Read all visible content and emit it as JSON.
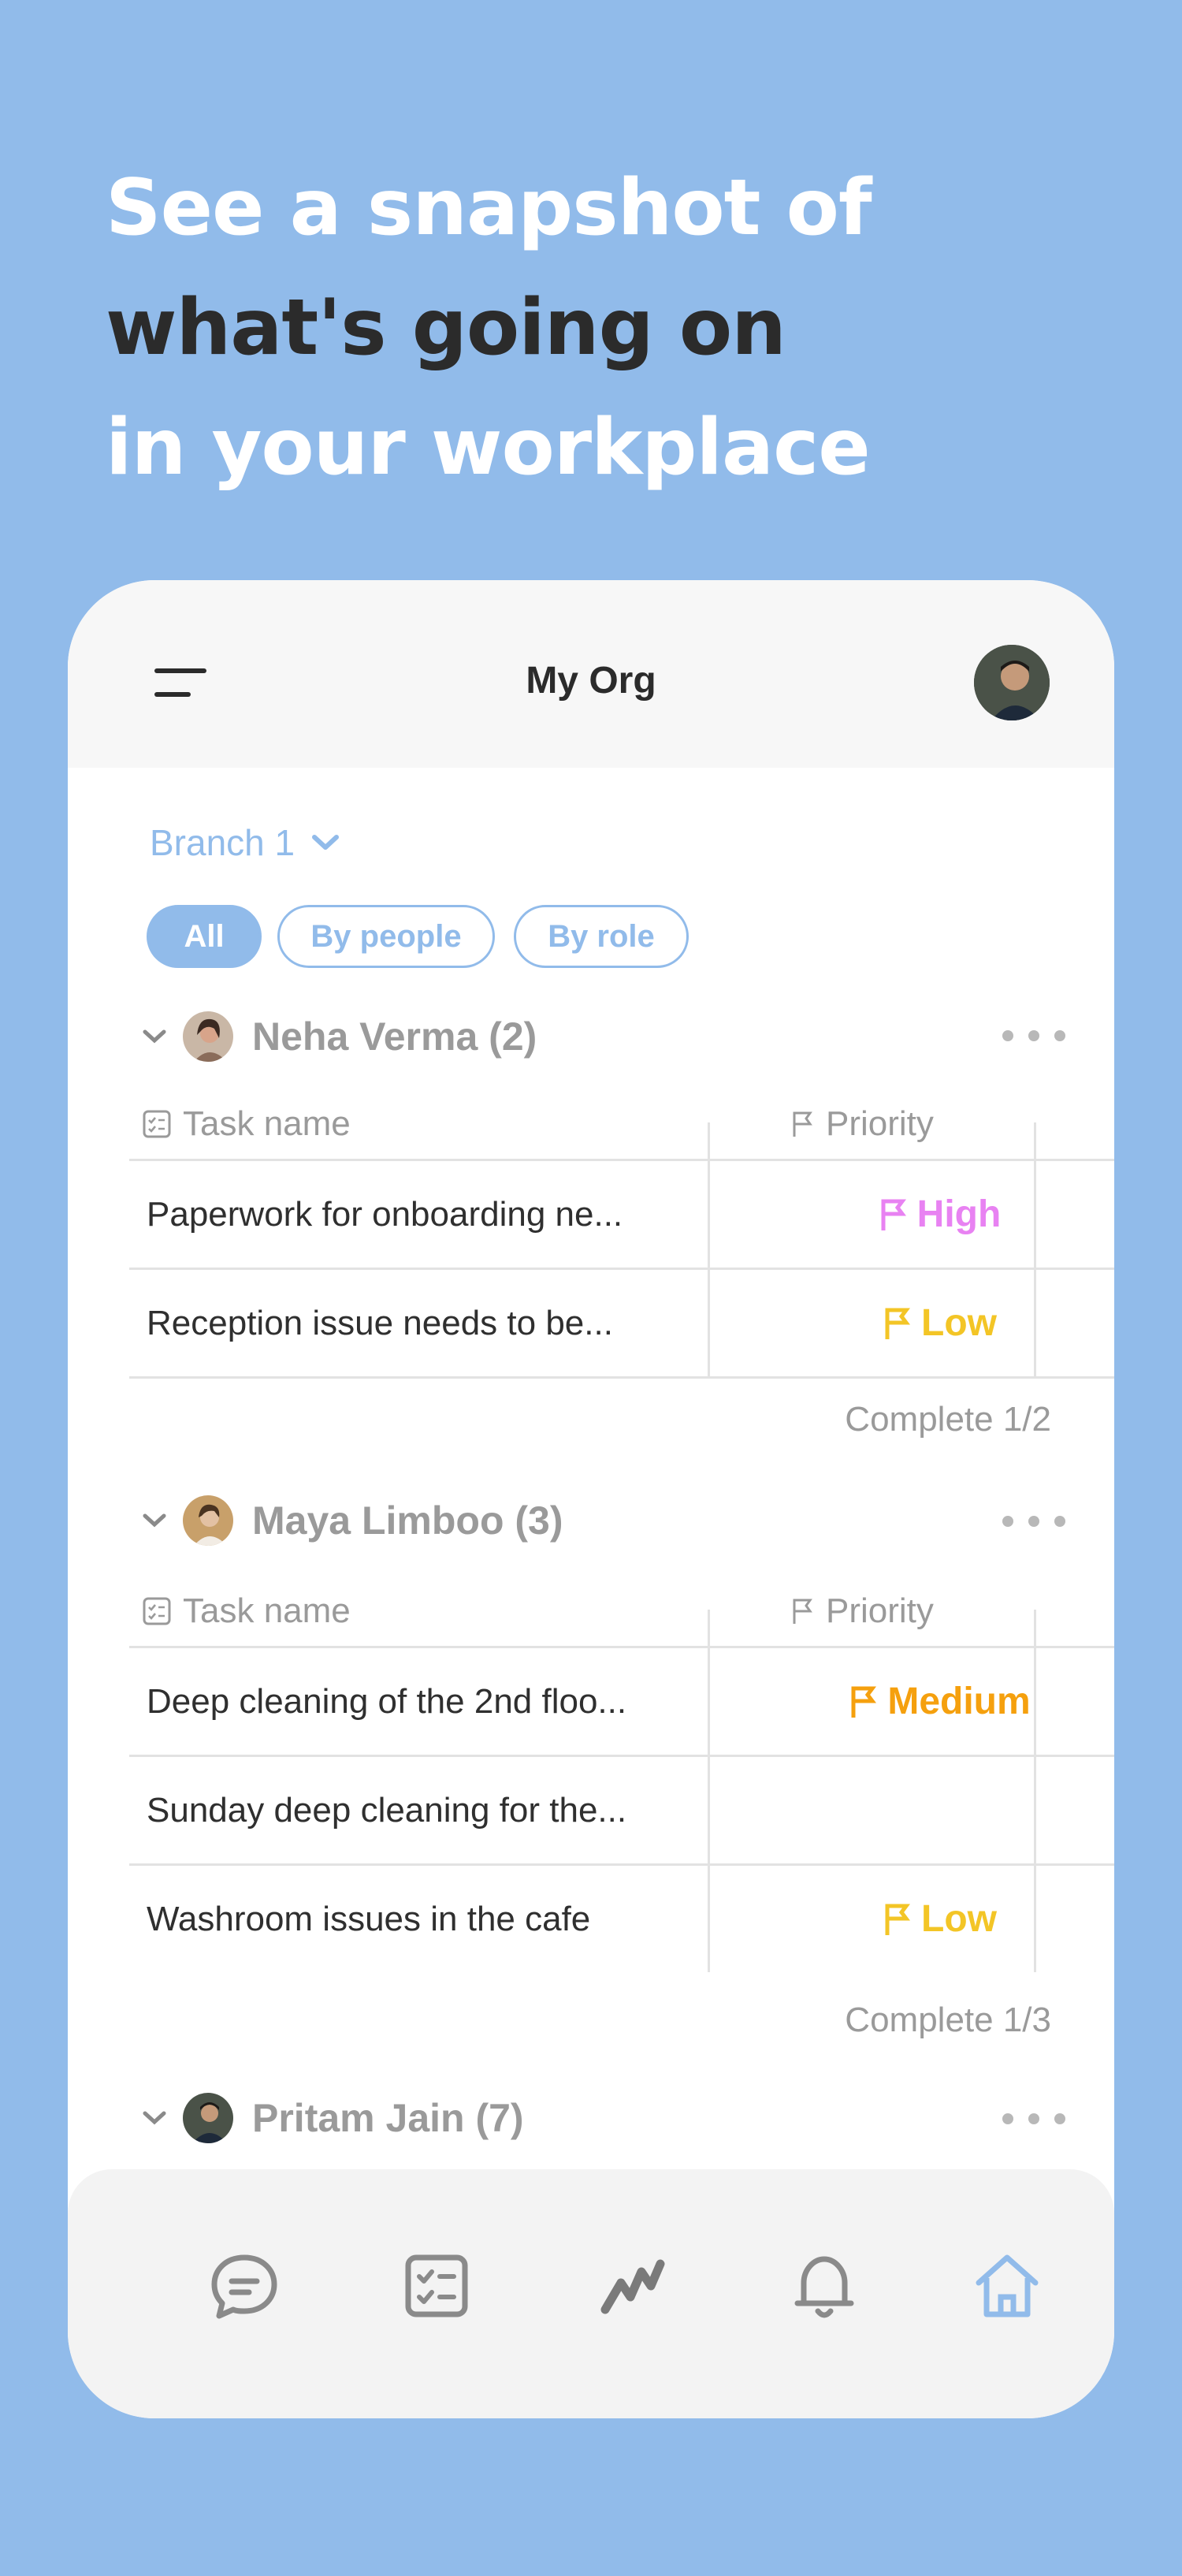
{
  "headline": {
    "line1": "See a snapshot of",
    "line2": "what's going on",
    "line3": "in your workplace"
  },
  "app": {
    "title": "My Org",
    "branch": "Branch 1",
    "filters": [
      "All",
      "By people",
      "By role"
    ]
  },
  "table_headers": {
    "task_name": "Task name",
    "priority": "Priority",
    "person_partial": "P"
  },
  "groups": [
    {
      "name": "Neha Verma (2)",
      "tasks": [
        {
          "name": "Paperwork for onboarding ne...",
          "priority": "High"
        },
        {
          "name": "Reception issue needs to be...",
          "priority": "Low"
        }
      ],
      "complete": "Complete 1/2"
    },
    {
      "name": "Maya Limboo (3)",
      "tasks": [
        {
          "name": "Deep cleaning of the 2nd floo...",
          "priority": "Medium"
        },
        {
          "name": "Sunday deep cleaning for the...",
          "priority": ""
        },
        {
          "name": "Washroom issues in the cafe",
          "priority": "Low"
        }
      ],
      "complete": "Complete 1/3"
    },
    {
      "name": "Pritam Jain (7)"
    }
  ],
  "priority_colors": {
    "High": "#e882f2",
    "Low": "#f3c526",
    "Medium": "#f5a00e"
  },
  "colors": {
    "background": "#91bbea",
    "accent": "#91bbea",
    "text_dark": "#2b2b2b",
    "muted": "#9a9a9a"
  },
  "nav": [
    {
      "icon": "chat-icon",
      "active": false
    },
    {
      "icon": "tasks-checklist-icon",
      "active": false
    },
    {
      "icon": "activity-icon",
      "active": false
    },
    {
      "icon": "bell-icon",
      "active": false
    },
    {
      "icon": "home-icon",
      "active": true
    }
  ]
}
